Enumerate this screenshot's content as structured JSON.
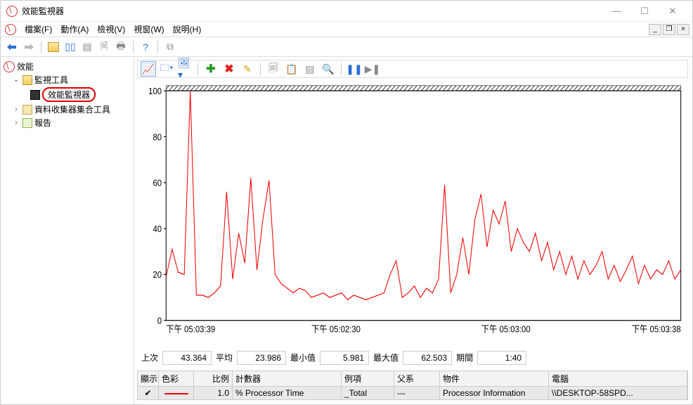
{
  "window": {
    "title": "效能監視器"
  },
  "menu": {
    "file": "檔案(F)",
    "action": "動作(A)",
    "view": "檢視(V)",
    "window": "視窗(W)",
    "help": "說明(H)"
  },
  "tree": {
    "root": "效能",
    "monitor_tools": "監視工具",
    "perf_monitor": "效能監視器",
    "collector": "資料收集器集合工具",
    "report": "報告"
  },
  "stats": {
    "last_label": "上次",
    "last_value": "43.364",
    "avg_label": "平均",
    "avg_value": "23.986",
    "min_label": "最小值",
    "min_value": "5.981",
    "max_label": "最大值",
    "max_value": "62.503",
    "dur_label": "期間",
    "dur_value": "1:40"
  },
  "columns": {
    "show": "顯示",
    "color": "色彩",
    "scale": "比例",
    "counter": "計數器",
    "instance": "例項",
    "parent": "父系",
    "object": "物件",
    "computer": "電腦"
  },
  "counter_row": {
    "show": "✔",
    "scale": "1.0",
    "counter": "% Processor Time",
    "instance": "_Total",
    "parent": "---",
    "object": "Processor Information",
    "computer": "\\\\DESKTOP-58SPD..."
  },
  "chart_data": {
    "type": "line",
    "title": "",
    "ylabel": "",
    "xlabel": "",
    "ylim": [
      0,
      100
    ],
    "y_ticks": [
      0,
      20,
      40,
      60,
      80,
      100
    ],
    "x_ticks": [
      "下午 05:03:39",
      "下午 05:02:30",
      "下午 05:03:00",
      "下午 05:03:38"
    ],
    "x_tick_pos": [
      0,
      0.33,
      0.66,
      1.0
    ],
    "series": [
      {
        "name": "% Processor Time",
        "color": "#e00",
        "values": [
          19,
          31,
          21,
          20,
          100,
          11,
          11,
          10,
          12,
          15,
          56,
          18,
          38,
          25,
          62,
          22,
          44,
          61,
          20,
          16,
          14,
          12,
          14,
          13,
          10,
          11,
          12,
          10,
          11,
          12,
          9,
          11,
          10,
          9,
          10,
          11,
          12,
          20,
          26,
          10,
          12,
          15,
          10,
          14,
          12,
          18,
          59,
          12,
          20,
          36,
          20,
          44,
          55,
          32,
          48,
          42,
          52,
          30,
          40,
          34,
          30,
          38,
          26,
          34,
          22,
          30,
          20,
          28,
          18,
          26,
          20,
          24,
          30,
          18,
          24,
          17,
          22,
          28,
          16,
          24,
          18,
          22,
          20,
          26,
          18,
          22
        ]
      }
    ]
  }
}
